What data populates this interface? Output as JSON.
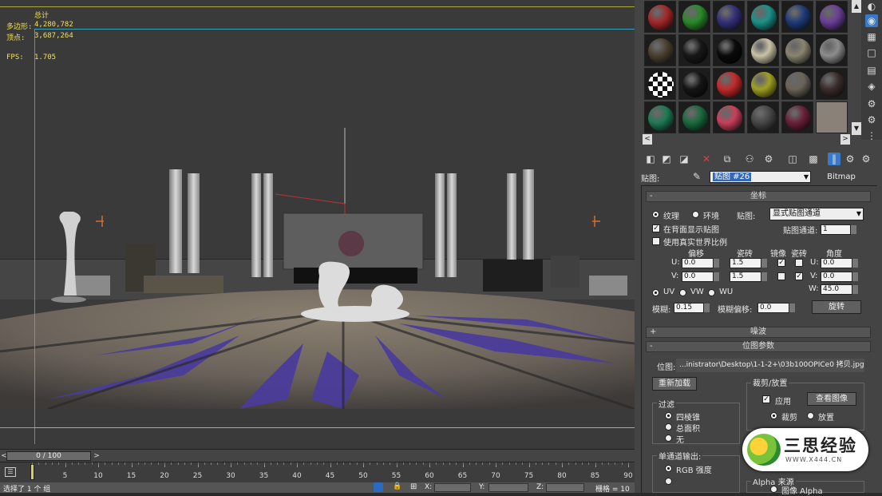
{
  "stats": {
    "total_label": "总计",
    "poly_label": "多边形:",
    "poly_value": "4,280,782",
    "vert_label": "顶点:",
    "vert_value": "3,687,264",
    "fps_label": "FPS:",
    "fps_value": "1.705"
  },
  "timeline": {
    "slider": "0 / 100",
    "prev": "<",
    "next": ">",
    "ticks": [
      "5",
      "10",
      "15",
      "20",
      "25",
      "30",
      "35",
      "40",
      "45",
      "50",
      "55",
      "60",
      "65",
      "70",
      "75",
      "80",
      "85",
      "90"
    ]
  },
  "status": {
    "message": "选择了 1 个 组",
    "x_label": "X:",
    "y_label": "Y:",
    "z_label": "Z:",
    "grid_label": "栅格 = 10"
  },
  "material_slots": {
    "colors": [
      "#a3282b",
      "#2a8a2a",
      "#34317a",
      "#1c9188",
      "#1f3c78",
      "#6a3f96",
      "#4a4030",
      "#181818",
      "#0a0a0a",
      "#c9c2a5",
      "#8a8570",
      "#8c8c8c",
      "#e8e8e8",
      "#151515",
      "#c22a2a",
      "#a0a024",
      "#6a6358",
      "#3a2c2c",
      "#1f7a55",
      "#1a6a3f",
      "#c8405a",
      "#474747",
      "#6a2038",
      "#8a8178"
    ],
    "scroll_left": "<",
    "scroll_right": ">"
  },
  "map_row": {
    "label": "贴图:",
    "map_name": "贴图 #26",
    "map_type": "Bitmap"
  },
  "coordinates": {
    "title": "坐标",
    "texture": "纹理",
    "environ": "环境",
    "mapping_label": "贴图:",
    "mapping_value": "显式贴图通道",
    "show_back": "在背面显示贴图",
    "map_channel_label": "贴图通道:",
    "map_channel_value": "1",
    "real_world": "使用真实世界比例",
    "offset": "偏移",
    "tiling": "瓷砖",
    "mirror": "镜像",
    "tile": "瓷砖",
    "angle": "角度",
    "u_label": "U:",
    "v_label": "V:",
    "w_label": "W:",
    "u_offset": "0.0",
    "v_offset": "0.0",
    "u_tiling": "1.5",
    "v_tiling": "1.5",
    "u_angle": "0.0",
    "v_angle": "0.0",
    "w_angle": "45.0",
    "uv": "UV",
    "vw": "VW",
    "wu": "WU",
    "blur_label": "模糊:",
    "blur_value": "0.15",
    "blur_offset_label": "模糊偏移:",
    "blur_offset_value": "0.0",
    "rotate": "旋转"
  },
  "noise": {
    "title": "噪波"
  },
  "bitmap": {
    "title": "位图参数",
    "path_label": "位图:",
    "path_value": "...inistrator\\Desktop\\1-1-2+\\03b100OPICe0 拷贝.jpg",
    "reload": "重新加载",
    "crop_group": "裁剪/放置",
    "apply": "应用",
    "view_image": "查看图像",
    "crop": "裁剪",
    "place": "放置",
    "filter_group": "过滤",
    "pyramidal": "四棱锥",
    "summed": "总面积",
    "none": "无",
    "mono_group": "单通道输出:",
    "rgb": "RGB 强度",
    "alpha_source": "Alpha 来源",
    "image_alpha": "图像 Alpha"
  },
  "watermark": {
    "title": "三思经验",
    "url": "WWW.X444.CN"
  }
}
